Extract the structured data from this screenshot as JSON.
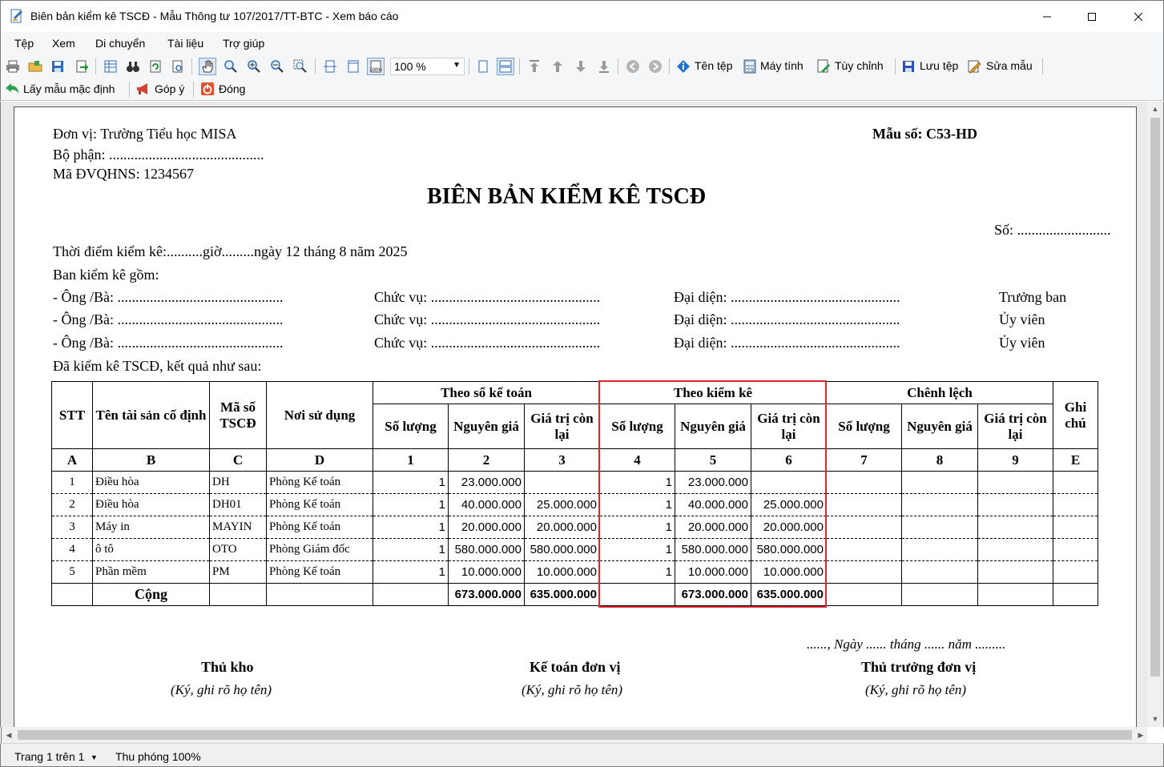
{
  "window": {
    "title": "Biên bản kiểm kê TSCĐ - Mẫu Thông tư 107/2017/TT-BTC - Xem báo cáo"
  },
  "menu": [
    "Tệp",
    "Xem",
    "Di chuyển",
    "Tài liệu",
    "Trợ giúp"
  ],
  "toolbar": {
    "zoom": "100 %",
    "file_name": "Tên tệp",
    "calculator": "Máy tính",
    "customize": "Tùy chỉnh",
    "save_file": "Lưu tệp",
    "edit_template": "Sửa mẫu",
    "default_template": "Lấy mẫu mặc định",
    "feedback": "Góp ý",
    "close": "Đóng"
  },
  "report": {
    "unit": "Đơn vị: Trường Tiểu học MISA",
    "department": "Bộ phận: ...........................................",
    "code": "Mã ĐVQHNS: 1234567",
    "form_no": "Mẫu số: C53-HD",
    "title": "BIÊN BẢN KIỂM KÊ TSCĐ",
    "number": "Số: ..........................",
    "time": "Thời điểm kiểm kê:..........giờ.........ngày 12 tháng 8 năm 2025",
    "committee": "Ban kiểm kê gồm:",
    "members": [
      {
        "person": "- Ông /Bà: ..............................................",
        "position": "Chức vụ: ...............................................",
        "rep": "Đại diện: ...............................................",
        "role": "Trưởng ban"
      },
      {
        "person": "- Ông /Bà: ..............................................",
        "position": "Chức vụ: ...............................................",
        "rep": "Đại diện: ...............................................",
        "role": "Ủy viên"
      },
      {
        "person": "- Ông /Bà: ..............................................",
        "position": "Chức vụ: ...............................................",
        "rep": "Đại diện: ...............................................",
        "role": "Ủy viên"
      }
    ],
    "result_intro": "Đã kiểm kê TSCĐ, kết quả như sau:",
    "headers": {
      "stt": "STT",
      "name": "Tên tài sản cố định",
      "code": "Mã số TSCĐ",
      "location": "Nơi sử dụng",
      "by_books": "Theo sổ kế toán",
      "by_count": "Theo kiểm kê",
      "difference": "Chênh lệch",
      "note": "Ghi chú",
      "qty": "Số lượng",
      "cost": "Nguyên giá",
      "residual": "Giá trị còn lại"
    },
    "col_codes": [
      "A",
      "B",
      "C",
      "D",
      "1",
      "2",
      "3",
      "4",
      "5",
      "6",
      "7",
      "8",
      "9",
      "E"
    ],
    "rows": [
      {
        "stt": "1",
        "name": "Điều hòa",
        "code": "DH",
        "location": "Phòng Kế toán",
        "qty1": "1",
        "cost1": "23.000.000",
        "res1": "",
        "qty2": "1",
        "cost2": "23.000.000",
        "res2": ""
      },
      {
        "stt": "2",
        "name": "Điều hòa",
        "code": "DH01",
        "location": "Phòng Kế toán",
        "qty1": "1",
        "cost1": "40.000.000",
        "res1": "25.000.000",
        "qty2": "1",
        "cost2": "40.000.000",
        "res2": "25.000.000"
      },
      {
        "stt": "3",
        "name": "Máy in",
        "code": "MAYIN",
        "location": "Phòng Kế toán",
        "qty1": "1",
        "cost1": "20.000.000",
        "res1": "20.000.000",
        "qty2": "1",
        "cost2": "20.000.000",
        "res2": "20.000.000"
      },
      {
        "stt": "4",
        "name": "ô tô",
        "code": "OTO",
        "location": "Phòng Giám đốc",
        "qty1": "1",
        "cost1": "580.000.000",
        "res1": "580.000.000",
        "qty2": "1",
        "cost2": "580.000.000",
        "res2": "580.000.000"
      },
      {
        "stt": "5",
        "name": "Phần mềm",
        "code": "PM",
        "location": "Phòng Kế toán",
        "qty1": "1",
        "cost1": "10.000.000",
        "res1": "10.000.000",
        "qty2": "1",
        "cost2": "10.000.000",
        "res2": "10.000.000"
      }
    ],
    "total": {
      "label": "Cộng",
      "cost1": "673.000.000",
      "res1": "635.000.000",
      "cost2": "673.000.000",
      "res2": "635.000.000"
    },
    "date_line": "......, Ngày ...... tháng ...... năm .........",
    "signatures": [
      {
        "title": "Thủ kho",
        "hint": "(Ký, ghi rõ họ tên)"
      },
      {
        "title": "Kế toán đơn vị",
        "hint": "(Ký, ghi rõ họ tên)"
      },
      {
        "title": "Thủ trưởng đơn vị",
        "hint": "(Ký, ghi rõ họ tên)"
      }
    ]
  },
  "status": {
    "page": "Trang 1 trên 1",
    "zoom": "Thu phóng 100%"
  },
  "colors": {
    "highlight": "#e0252a"
  }
}
